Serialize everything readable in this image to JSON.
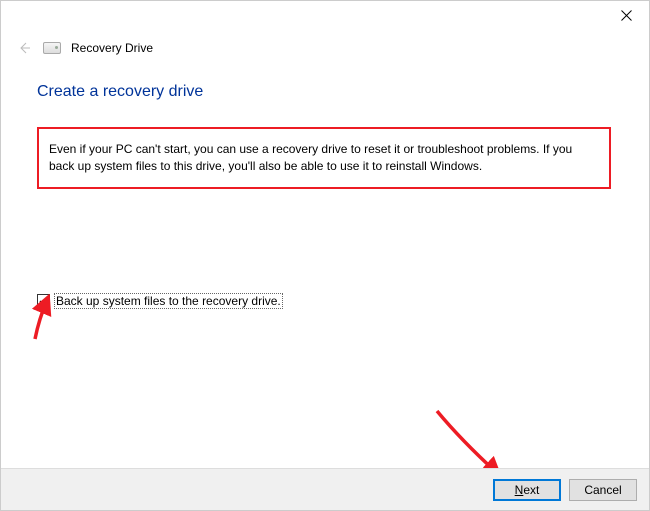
{
  "window": {
    "title": "Recovery Drive"
  },
  "page": {
    "heading": "Create a recovery drive",
    "description": "Even if your PC can't start, you can use a recovery drive to reset it or troubleshoot problems. If you back up system files to this drive, you'll also be able to use it to reinstall Windows."
  },
  "checkbox": {
    "label": "Back up system files to the recovery drive.",
    "checked": true
  },
  "buttons": {
    "next": "Next",
    "cancel": "Cancel"
  },
  "annotations": {
    "highlight_color": "#ed1c24"
  }
}
